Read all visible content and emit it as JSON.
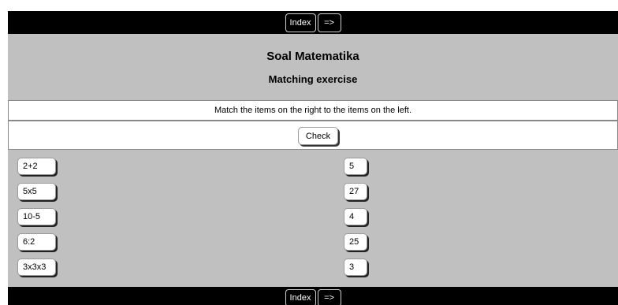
{
  "nav": {
    "index_label": "Index",
    "next_label": "=>"
  },
  "header": {
    "title": "Soal Matematika",
    "subtitle": "Matching exercise"
  },
  "instructions": "Match the items on the right to the items on the left.",
  "check_label": "Check",
  "left_items": [
    "2+2",
    "5x5",
    "10-5",
    "6:2",
    "3x3x3"
  ],
  "right_items": [
    "5",
    "27",
    "4",
    "25",
    "3"
  ],
  "colors": {
    "background": "#c0c0c0",
    "navbar": "#000000",
    "panel": "#ffffff"
  }
}
